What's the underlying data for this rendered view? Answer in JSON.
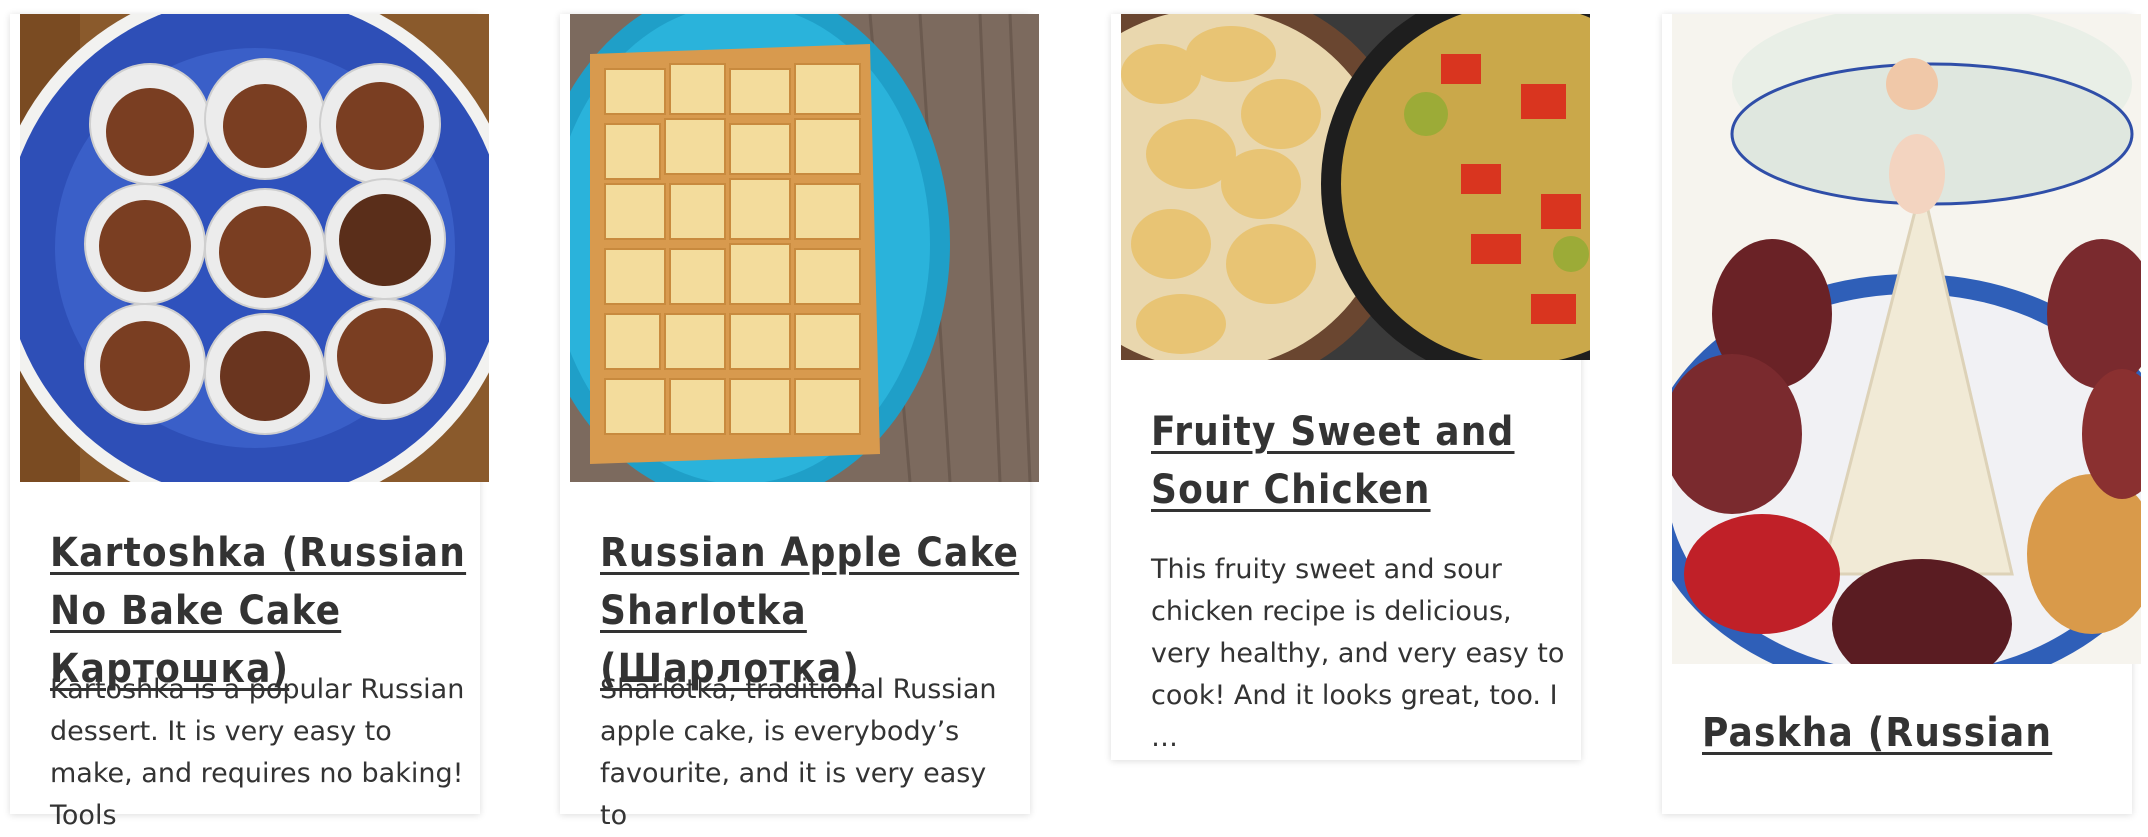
{
  "cards": [
    {
      "title": "Kartoshka (Russian No Bake Cake Картошка)",
      "excerpt": "Kartoshka is a popular Russian dessert. It is very easy to make, and requires no baking! Tools",
      "image_alt": "chocolate truffle balls in paper cups on a blue plate"
    },
    {
      "title": "Russian Apple Cake Sharlotka (Шарлотка)",
      "excerpt": "Sharlotka, traditional Russian apple cake, is everybody’s favourite, and it is very easy to",
      "image_alt": "square apple cake on a turquoise plate"
    },
    {
      "title": "Fruity Sweet and Sour Chicken",
      "excerpt": "This fruity sweet and sour chicken recipe is delicious, very healthy, and very easy to cook! And it looks great, too. I …",
      "image_alt": "fried chicken pieces in a pan next to a pot of sauce with vegetables"
    },
    {
      "title": "Paskha (Russian",
      "excerpt": "",
      "image_alt": "white paskha dessert with an angel figurine surrounded by painted eggs"
    }
  ]
}
